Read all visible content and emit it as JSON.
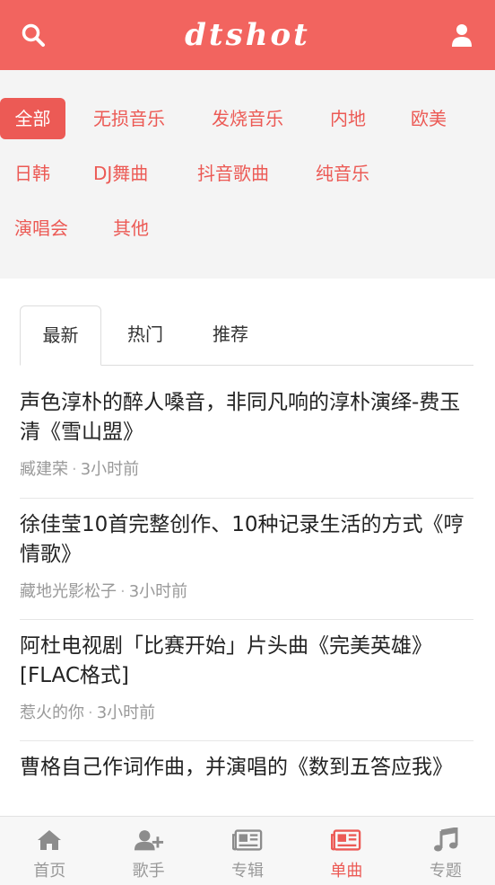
{
  "header": {
    "logo": "dtshot",
    "search_icon": "search-icon",
    "user_icon": "user-icon"
  },
  "categories": [
    "全部",
    "无损音乐",
    "发烧音乐",
    "内地",
    "欧美",
    "日韩",
    "DJ舞曲",
    "抖音歌曲",
    "纯音乐",
    "演唱会",
    "其他"
  ],
  "tabs": [
    "最新",
    "热门",
    "推荐"
  ],
  "articles": [
    {
      "title": "声色淳朴的醉人嗓音，非同凡响的淳朴演绎-费玉清《雪山盟》",
      "author": "臧建荣",
      "time": "3小时前"
    },
    {
      "title": "徐佳莹10首完整创作、10种记录生活的方式《哼情歌》",
      "author": "藏地光影松子",
      "time": "3小时前"
    },
    {
      "title": "阿杜电视剧「比赛开始」片头曲《完美英雄》[FLAC格式]",
      "author": "惹火的你",
      "time": "3小时前"
    },
    {
      "title": "曹格自己作词作曲，并演唱的《数到五答应我》",
      "author": "",
      "time": ""
    }
  ],
  "footer": [
    {
      "label": "首页",
      "icon": "home-icon"
    },
    {
      "label": "歌手",
      "icon": "add-user-icon"
    },
    {
      "label": "专辑",
      "icon": "newspaper-icon"
    },
    {
      "label": "单曲",
      "icon": "newspaper-icon"
    },
    {
      "label": "专题",
      "icon": "music-note-icon"
    }
  ],
  "colors": {
    "accent": "#f2645f",
    "accent_text": "#ec5a55"
  }
}
